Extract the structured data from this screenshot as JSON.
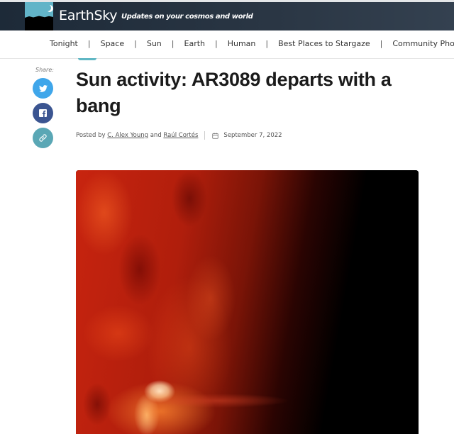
{
  "header": {
    "brand": "EarthSky",
    "tagline": "Updates on your cosmos and world",
    "logo_icon": "earthsky-logo-icon"
  },
  "nav": {
    "items": [
      {
        "label": "Tonight"
      },
      {
        "label": "Space"
      },
      {
        "label": "Sun"
      },
      {
        "label": "Earth"
      },
      {
        "label": "Human"
      },
      {
        "label": "Best Places to Stargaze"
      },
      {
        "label": "Community Photo"
      }
    ],
    "separator": "|"
  },
  "share": {
    "label": "Share:",
    "buttons": [
      {
        "name": "twitter",
        "icon": "twitter-icon",
        "color": "#3fa6ea"
      },
      {
        "name": "facebook",
        "icon": "facebook-icon",
        "color": "#3b5591"
      },
      {
        "name": "copy-link",
        "icon": "link-icon",
        "color": "#5aa7b5"
      }
    ]
  },
  "article": {
    "title": "Sun activity: AR3089 departs with a bang",
    "posted_by_label": "Posted by",
    "authors": [
      "C. Alex Young",
      "Raúl Cortés"
    ],
    "and_label": "and",
    "date": "September 7, 2022",
    "hero_image_alt": "Solar flare erupting on the sun's limb in red ultraviolet light"
  },
  "colors": {
    "header_bg": "#1d2a38",
    "accent_teal": "#5fb7c4",
    "title_text": "#1b1b1b"
  }
}
